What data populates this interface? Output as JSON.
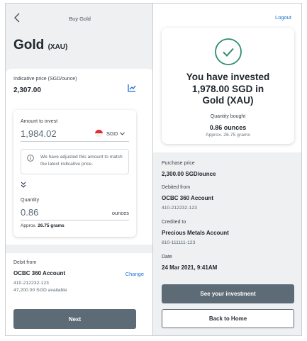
{
  "left_screen": {
    "header_title": "Buy Gold",
    "back_icon": "chevron-left-icon",
    "heading": "Gold",
    "heading_symbol": "(XAU)",
    "indicative_label": "Indicative price (SGD/ounce)",
    "indicative_value": "2,307.00",
    "chart_icon": "bar-chart-icon",
    "amount_label": "Amount to invest",
    "amount_value": "1,984.02",
    "currency_code": "SGD",
    "currency_flag_icon": "singapore-flag-icon",
    "notice_icon": "info-icon",
    "notice_text": "We have adjusted this amount to match the latest indicative price.",
    "swap_icon": "double-chevron-down-icon",
    "quantity_label": "Quantity",
    "quantity_value": "0.86",
    "quantity_unit": "ounces",
    "approx_prefix": "Approx.",
    "approx_value": "26.75 grams",
    "debit_label": "Debit from",
    "debit_account": "OCBC 360 Account",
    "debit_change": "Change",
    "debit_number": "410-212232-123",
    "debit_available": "47,200.00 SGD available",
    "next_button": "Next"
  },
  "right_screen": {
    "logout": "Logout",
    "success_icon": "check-circle-icon",
    "success_line1": "You have invested",
    "success_line2": "1,978.00 SGD in",
    "success_line3": "Gold (XAU)",
    "qty_bought_label": "Quantity bought",
    "qty_bought_value": "0.86 ounces",
    "qty_bought_approx": "Approx. 26.75 grams",
    "purchase_price_label": "Purchase price",
    "purchase_price_value": "2,300.00 SGD/ounce",
    "debited_from_label": "Debited from",
    "debited_from_value": "OCBC 360 Account",
    "debited_from_number": "410-212232-123",
    "credited_to_label": "Credited to",
    "credited_to_value": "Precious Metals Account",
    "credited_to_number": "810-111111-123",
    "date_label": "Date",
    "date_value": "24 Mar 2021, 9:41AM",
    "see_investment_button": "See your investment",
    "back_home_button": "Back to Home"
  },
  "colors": {
    "accent_link": "#1f6fd1",
    "primary_button": "#5d6b76",
    "success_green": "#2e8c6f",
    "page_grey": "#eef0f2"
  }
}
